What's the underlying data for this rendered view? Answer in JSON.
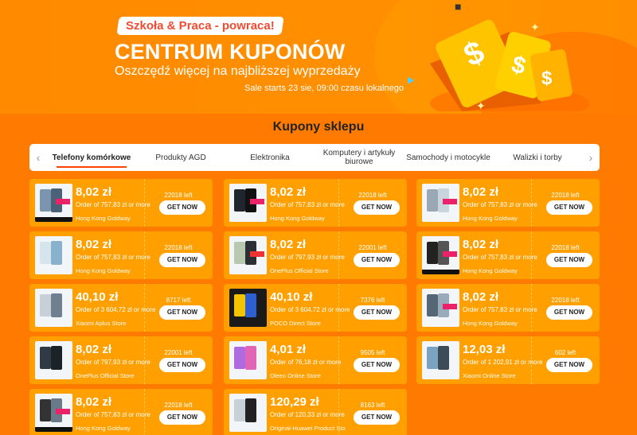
{
  "hero": {
    "tagline": "Szkoła & Praca - powraca!",
    "title": "CENTRUM KUPONÓW",
    "subtitle": "Oszczędź więcej na najbliższej wyprzedaży",
    "sale_info": "Sale starts 23 sie, 09:00 czasu lokalnego"
  },
  "section": {
    "title": "Kupony sklepu"
  },
  "tabs": [
    {
      "label": "Telefony komórkowe",
      "active": true
    },
    {
      "label": "Produkty AGD",
      "active": false
    },
    {
      "label": "Elektronika",
      "active": false
    },
    {
      "label": "Komputery i artykuły biurowe",
      "active": false
    },
    {
      "label": "Samochody i motocykle",
      "active": false
    },
    {
      "label": "Walizki i torby",
      "active": false
    }
  ],
  "coupons": [
    {
      "amount": "8,02 zł",
      "order": "Order of 757,83 zł or more",
      "store": "Hong Kong Goldway",
      "left": "22018 left",
      "cta": "GET NOW"
    },
    {
      "amount": "8,02 zł",
      "order": "Order of 757,83 zł or more",
      "store": "Hong Kong Goldway",
      "left": "22018 left",
      "cta": "GET NOW"
    },
    {
      "amount": "8,02 zł",
      "order": "Order of 757,83 zł or more",
      "store": "Hong Kong Goldway",
      "left": "22018 left",
      "cta": "GET NOW"
    },
    {
      "amount": "8,02 zł",
      "order": "Order of 757,83 zł or more",
      "store": "Hong Kong Goldway",
      "left": "22018 left",
      "cta": "GET NOW"
    },
    {
      "amount": "8,02 zł",
      "order": "Order of 797,93 zł or more",
      "store": "OnePlus Official Store",
      "left": "22001 left",
      "cta": "GET NOW"
    },
    {
      "amount": "8,02 zł",
      "order": "Order of 757,83 zł or more",
      "store": "Hong Kong Goldway",
      "left": "22018 left",
      "cta": "GET NOW"
    },
    {
      "amount": "40,10 zł",
      "order": "Order of 3 604,72 zł or more",
      "store": "Xiaomi Aplus Store",
      "left": "8717 left",
      "cta": "GET NOW"
    },
    {
      "amount": "40,10 zł",
      "order": "Order of 3 604,72 zł or more",
      "store": "POCO Direct Store",
      "left": "7376 left",
      "cta": "GET NOW"
    },
    {
      "amount": "8,02 zł",
      "order": "Order of 757,83 zł or more",
      "store": "Hong Kong Goldway",
      "left": "22018 left",
      "cta": "GET NOW"
    },
    {
      "amount": "8,02 zł",
      "order": "Order of 797,93 zł or more",
      "store": "OnePlus Official Store",
      "left": "22001 left",
      "cta": "GET NOW"
    },
    {
      "amount": "4,01 zł",
      "order": "Order of 76,18 zł or more",
      "store": "Oleeo Online Store",
      "left": "9505 left",
      "cta": "GET NOW"
    },
    {
      "amount": "12,03 zł",
      "order": "Order of 1 202,91 zł or more",
      "store": "Xiaomi Online Store",
      "left": "602 left",
      "cta": "GET NOW"
    },
    {
      "amount": "8,02 zł",
      "order": "Order of 757,83 zł or more",
      "store": "Hong Kong Goldway",
      "left": "22018 left",
      "cta": "GET NOW"
    },
    {
      "amount": "120,29 zł",
      "order": "Order of 120,33 zł or more",
      "store": "Original-Huawei Product Sto",
      "left": "8163 left",
      "cta": "GET NOW"
    }
  ]
}
